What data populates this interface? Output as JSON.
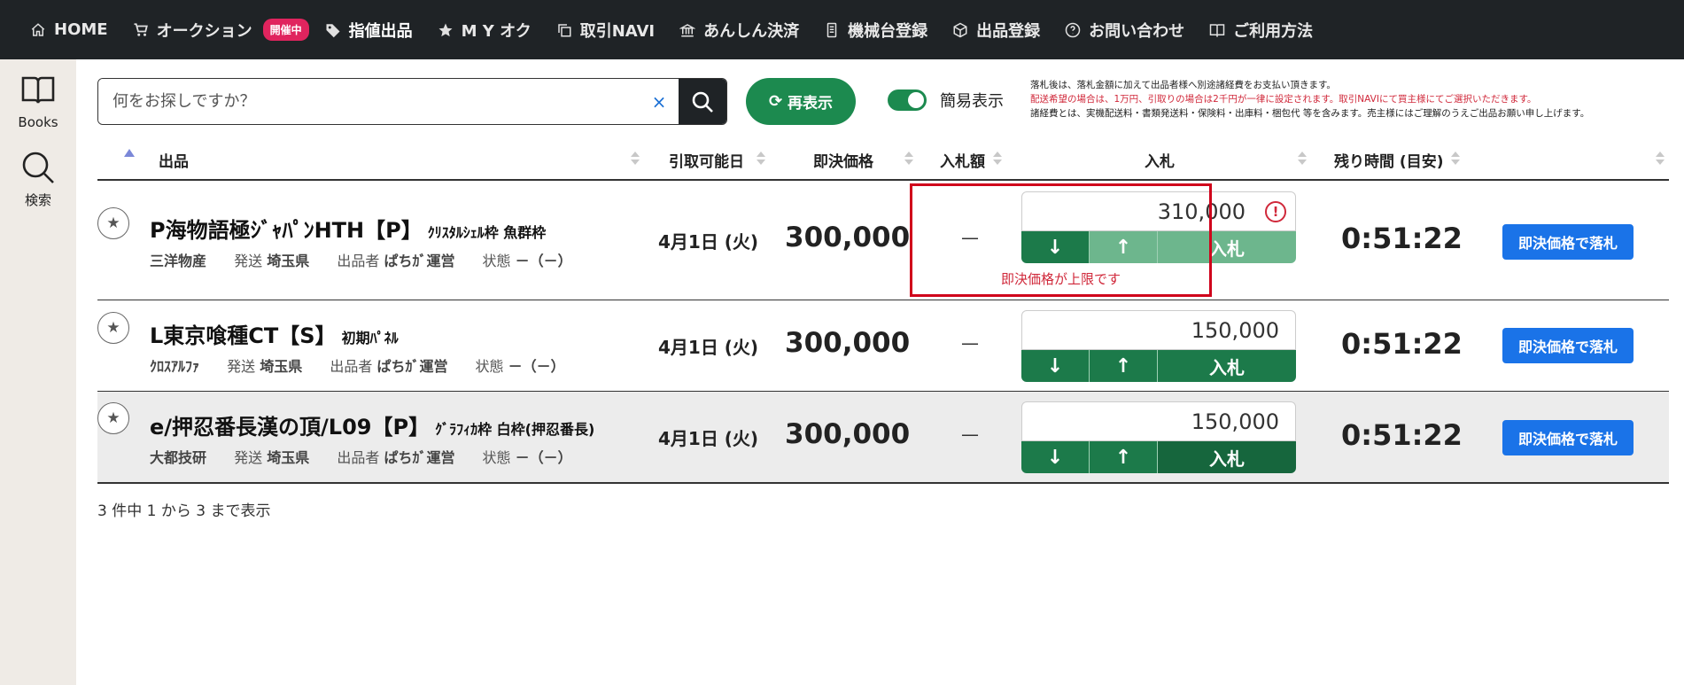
{
  "nav": [
    {
      "label": "HOME",
      "icon": "home-icon"
    },
    {
      "label": "オークション",
      "icon": "cart-icon"
    },
    {
      "label": "指値出品",
      "icon": "tag-icon"
    },
    {
      "label": "M Y オク",
      "icon": "star-icon"
    },
    {
      "label": "取引NAVI",
      "icon": "copy-icon"
    },
    {
      "label": "あんしん決済",
      "icon": "bank-icon"
    },
    {
      "label": "機械台登録",
      "icon": "machine-icon"
    },
    {
      "label": "出品登録",
      "icon": "box-icon"
    },
    {
      "label": "お問い合わせ",
      "icon": "help-icon"
    },
    {
      "label": "ご利用方法",
      "icon": "book-icon"
    }
  ],
  "badge": "開催中",
  "sidebar": [
    {
      "label": "Books",
      "icon": "book-open-icon"
    },
    {
      "label": "検索",
      "icon": "search-icon"
    }
  ],
  "search": {
    "placeholder": "何をお探しですか？",
    "clear": "×"
  },
  "refresh_label": "再表示",
  "toggle_label": "簡易表示",
  "notice": {
    "line1": "落札後は、落札金額に加えて出品者様へ別途諸経費をお支払い頂きます。",
    "line2": "配送希望の場合は、1万円、引取りの場合は2千円が一律に設定されます。取引NAVIにて買主様にてご選択いただきます。",
    "line3": "諸経費とは、実機配送料・書類発送料・保険料・出庫料・梱包代 等を含みます。売主様にはご理解のうえご出品お願い申し上げます。"
  },
  "headers": {
    "item": "出品",
    "pickup": "引取可能日",
    "buynow": "即決価格",
    "bid_amount": "入札額",
    "bid": "入札",
    "remaining": "残り時間 (目安)"
  },
  "rows": [
    {
      "title": "P海物語極ｼﾞｬﾊﾟﾝHTH【P】",
      "subtitle": "ｸﾘｽﾀﾙｼｪﾙ枠 魚群枠",
      "maker": "三洋物産",
      "ship_label": "発送",
      "ship_value": "埼玉県",
      "seller_label": "出品者",
      "seller_value": "ぱちｶﾞ運営",
      "state_label": "状態",
      "state_value": "－（－）",
      "date": "4月1日 (火)",
      "price": "300,000",
      "bid_amount": "—",
      "bid_value": "310,000",
      "error": "即決価格が上限です",
      "timer": "0:51:22",
      "buy_label": "即決価格で落札"
    },
    {
      "title": "L東京喰種CT【S】",
      "subtitle": "初期ﾊﾟﾈﾙ",
      "maker": "ｸﾛｽｱﾙﾌｧ",
      "ship_label": "発送",
      "ship_value": "埼玉県",
      "seller_label": "出品者",
      "seller_value": "ぱちｶﾞ運営",
      "state_label": "状態",
      "state_value": "－（－）",
      "date": "4月1日 (火)",
      "price": "300,000",
      "bid_amount": "—",
      "bid_value": "150,000",
      "timer": "0:51:22",
      "buy_label": "即決価格で落札"
    },
    {
      "title": "e/押忍番長漢の頂/L09【P】",
      "subtitle": "ｸﾞﾗﾌｨｶ枠 白枠(押忍番長)",
      "maker": "大都技研",
      "ship_label": "発送",
      "ship_value": "埼玉県",
      "seller_label": "出品者",
      "seller_value": "ぱちｶﾞ運営",
      "state_label": "状態",
      "state_value": "－（－）",
      "date": "4月1日 (火)",
      "price": "300,000",
      "bid_amount": "—",
      "bid_value": "150,000",
      "timer": "0:51:22",
      "buy_label": "即決価格で落札"
    }
  ],
  "bid_buttons": {
    "down": "↓",
    "up": "↑",
    "bid": "入札"
  },
  "footer": "3 件中 1 から 3 まで表示",
  "colors": {
    "nav_bg": "#1f2326",
    "green": "#1c8a4f",
    "blue": "#1a73e8",
    "error_red": "#d0021b",
    "badge": "#e0245e"
  }
}
